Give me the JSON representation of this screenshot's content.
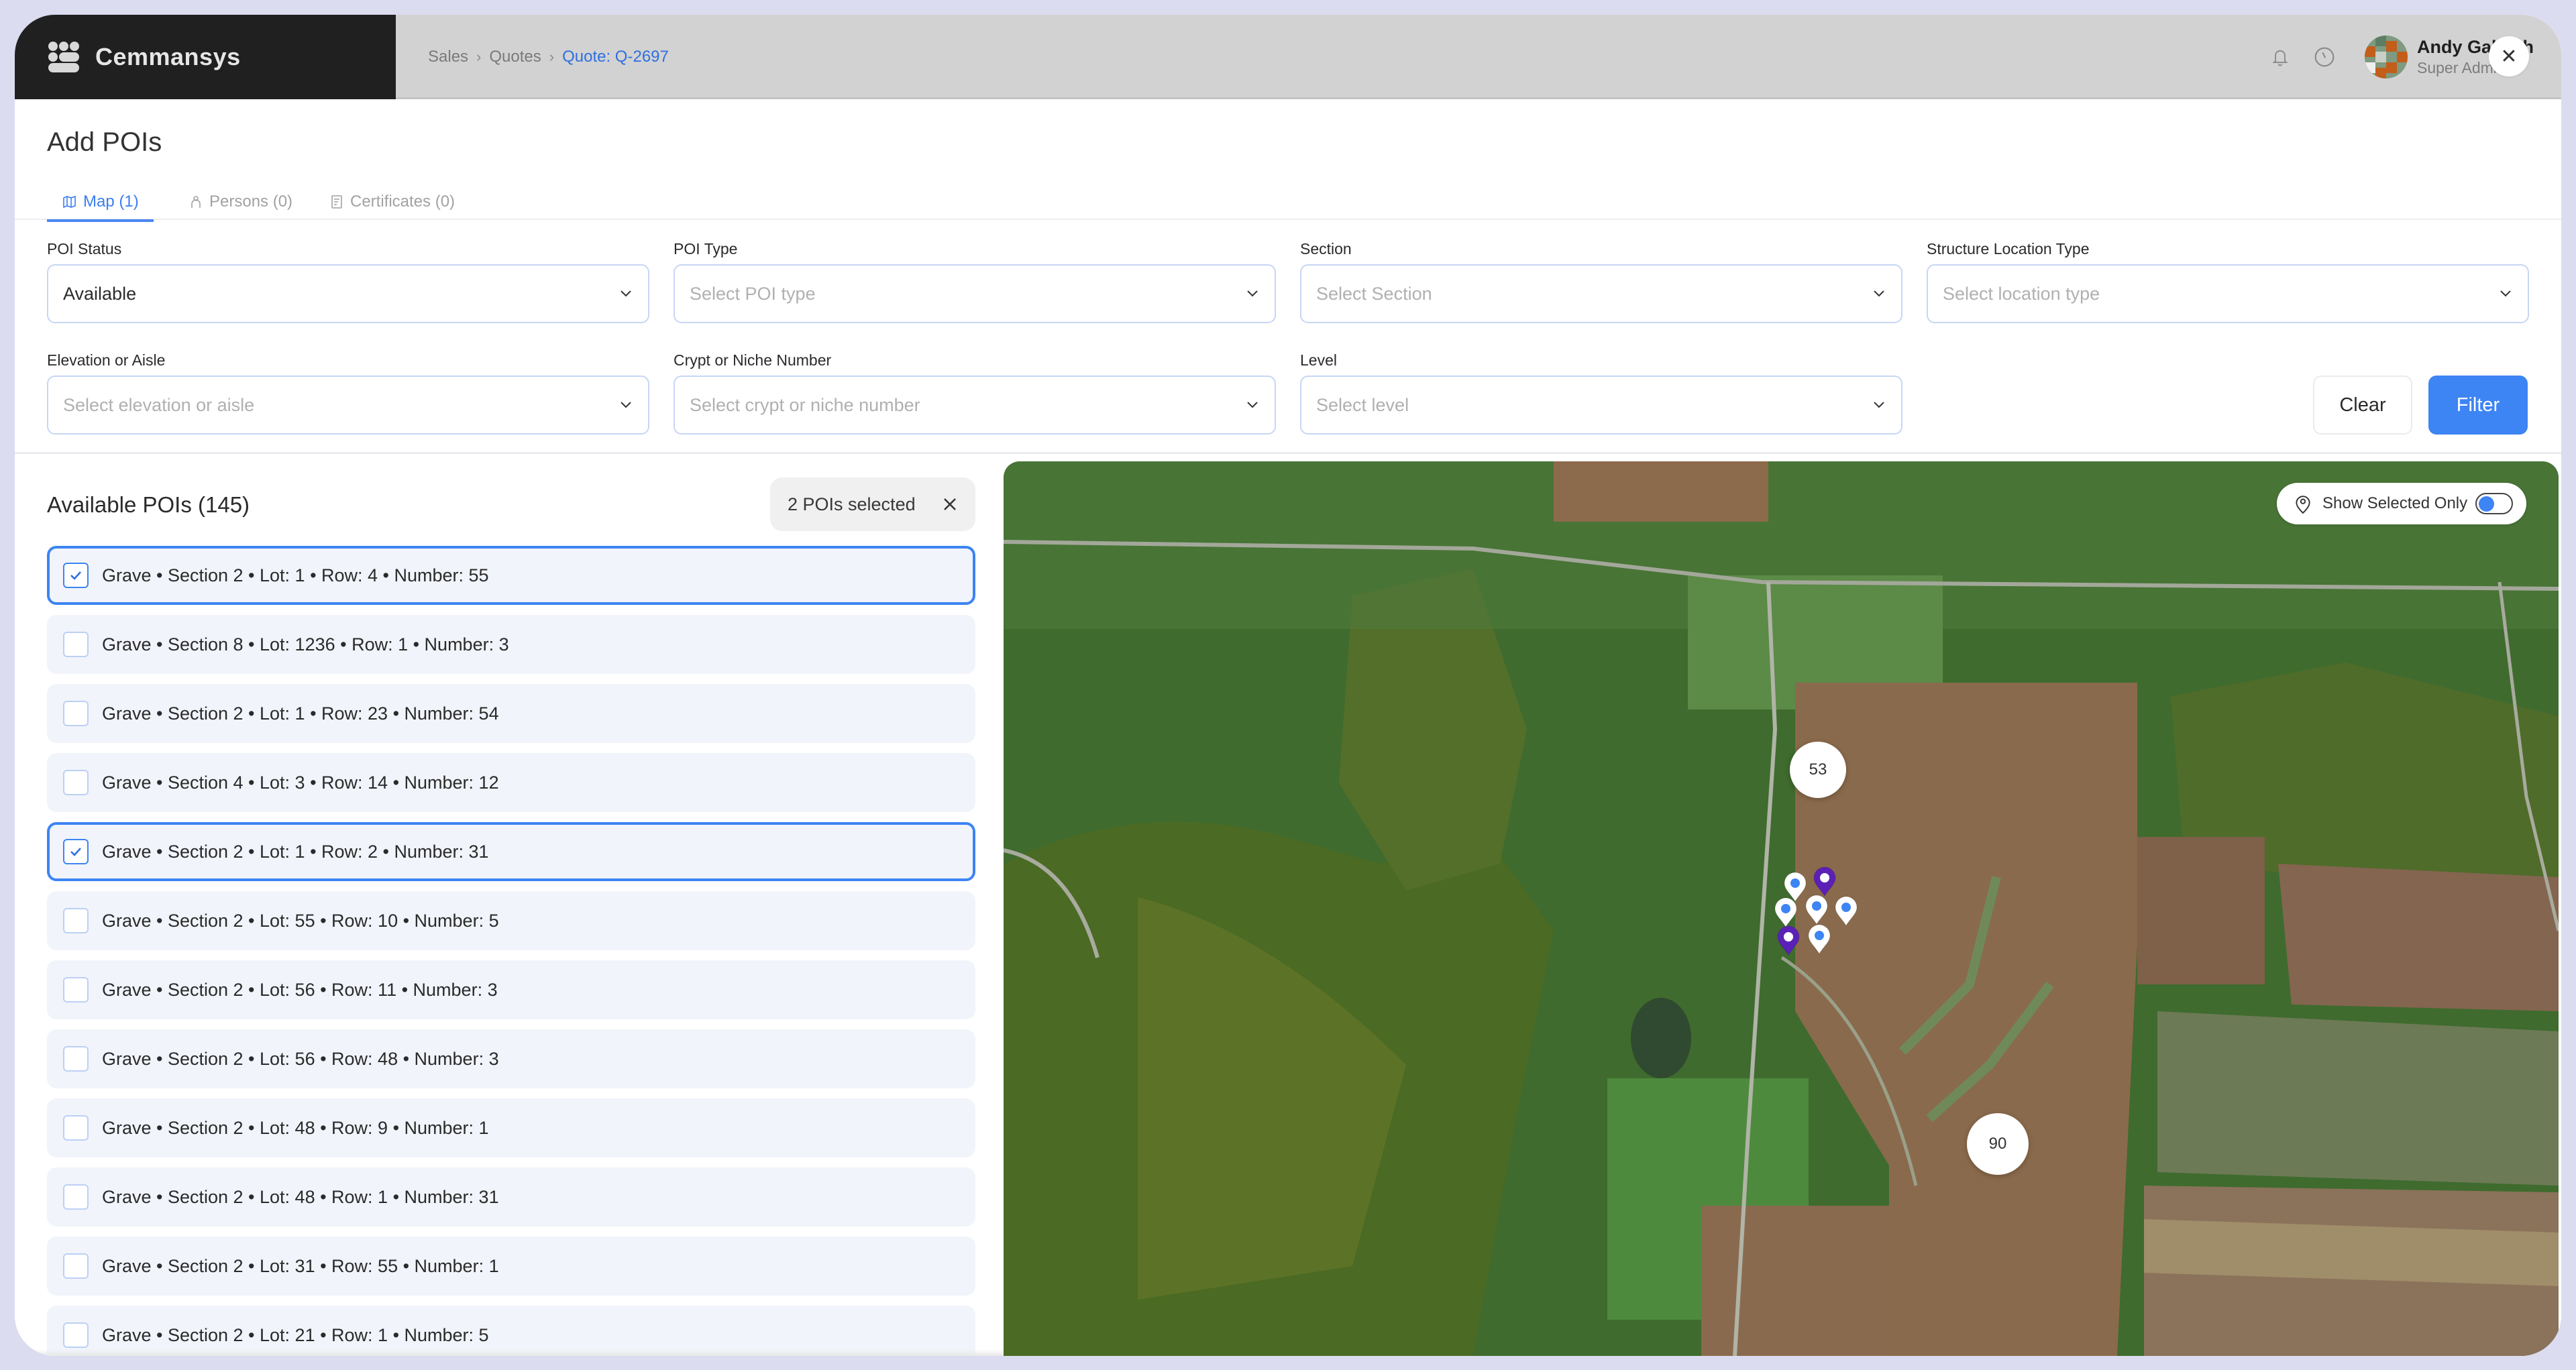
{
  "app": {
    "brand": "Cemmansys",
    "breadcrumb": [
      "Sales",
      "Quotes",
      "Quote: Q-2697"
    ],
    "user": {
      "name": "Andy Gallagher",
      "role": "Super Admin"
    },
    "icons": {
      "notifications": "bell-icon",
      "history": "clock-icon",
      "close": "close-icon",
      "logo": "logo-icon"
    }
  },
  "page": {
    "title": "Add POIs",
    "tabs": [
      {
        "label": "Map (1)",
        "icon": "map-icon",
        "active": true
      },
      {
        "label": "Persons (0)",
        "icon": "persons-icon",
        "active": false
      },
      {
        "label": "Certificates (0)",
        "icon": "certificate-icon",
        "active": false
      }
    ]
  },
  "filters": {
    "poi_status": {
      "label": "POI Status",
      "value": "Available",
      "placeholder": ""
    },
    "poi_type": {
      "label": "POI Type",
      "value": "",
      "placeholder": "Select POI type"
    },
    "section": {
      "label": "Section",
      "value": "",
      "placeholder": "Select Section"
    },
    "structure_location_type": {
      "label": "Structure Location Type",
      "value": "",
      "placeholder": "Select location type"
    },
    "elevation_or_aisle": {
      "label": "Elevation or Aisle",
      "value": "",
      "placeholder": "Select elevation or aisle"
    },
    "crypt_or_niche": {
      "label": "Crypt or Niche Number",
      "value": "",
      "placeholder": "Select crypt or niche number"
    },
    "level": {
      "label": "Level",
      "value": "",
      "placeholder": "Select level"
    },
    "clear_label": "Clear",
    "filter_label": "Filter"
  },
  "list": {
    "title": "Available POIs (145)",
    "selected_chip": "2 POIs selected",
    "items": [
      {
        "label": "Grave • Section 2 • Lot: 1 • Row: 4 • Number: 55",
        "checked": true
      },
      {
        "label": "Grave • Section 8 • Lot: 1236 • Row: 1 • Number: 3",
        "checked": false
      },
      {
        "label": "Grave • Section 2 • Lot: 1 • Row: 23 • Number: 54",
        "checked": false
      },
      {
        "label": "Grave • Section 4 • Lot: 3 • Row: 14 • Number: 12",
        "checked": false
      },
      {
        "label": "Grave • Section 2 • Lot: 1 • Row: 2 • Number: 31",
        "checked": true
      },
      {
        "label": "Grave • Section 2 • Lot: 55 • Row: 10 • Number: 5",
        "checked": false
      },
      {
        "label": "Grave • Section 2 • Lot: 56 • Row: 11 • Number: 3",
        "checked": false
      },
      {
        "label": "Grave • Section 2 • Lot: 56 • Row: 48 • Number: 3",
        "checked": false
      },
      {
        "label": "Grave • Section 2 • Lot: 48 • Row: 9 • Number: 1",
        "checked": false
      },
      {
        "label": "Grave • Section 2 • Lot: 48 • Row: 1 • Number: 31",
        "checked": false
      },
      {
        "label": "Grave • Section 2 • Lot: 31 • Row: 55 • Number: 1",
        "checked": false
      },
      {
        "label": "Grave • Section 2 • Lot: 21 • Row: 1 • Number: 5",
        "checked": false
      }
    ]
  },
  "map": {
    "toggle_label": "Show Selected Only",
    "toggle_on": true,
    "clusters": [
      {
        "count": "53"
      },
      {
        "count": "90"
      }
    ],
    "markers": [
      {
        "type": "unselected"
      },
      {
        "type": "selected"
      },
      {
        "type": "unselected"
      },
      {
        "type": "unselected"
      },
      {
        "type": "unselected"
      },
      {
        "type": "selected"
      },
      {
        "type": "unselected"
      }
    ],
    "colors": {
      "selected_marker": "#5b21b6",
      "unselected_marker_dot": "#3d84f4"
    }
  },
  "colors": {
    "accent": "#3d84f4",
    "brand_bg": "#202020",
    "topbar_bg": "#d2d2d2"
  }
}
